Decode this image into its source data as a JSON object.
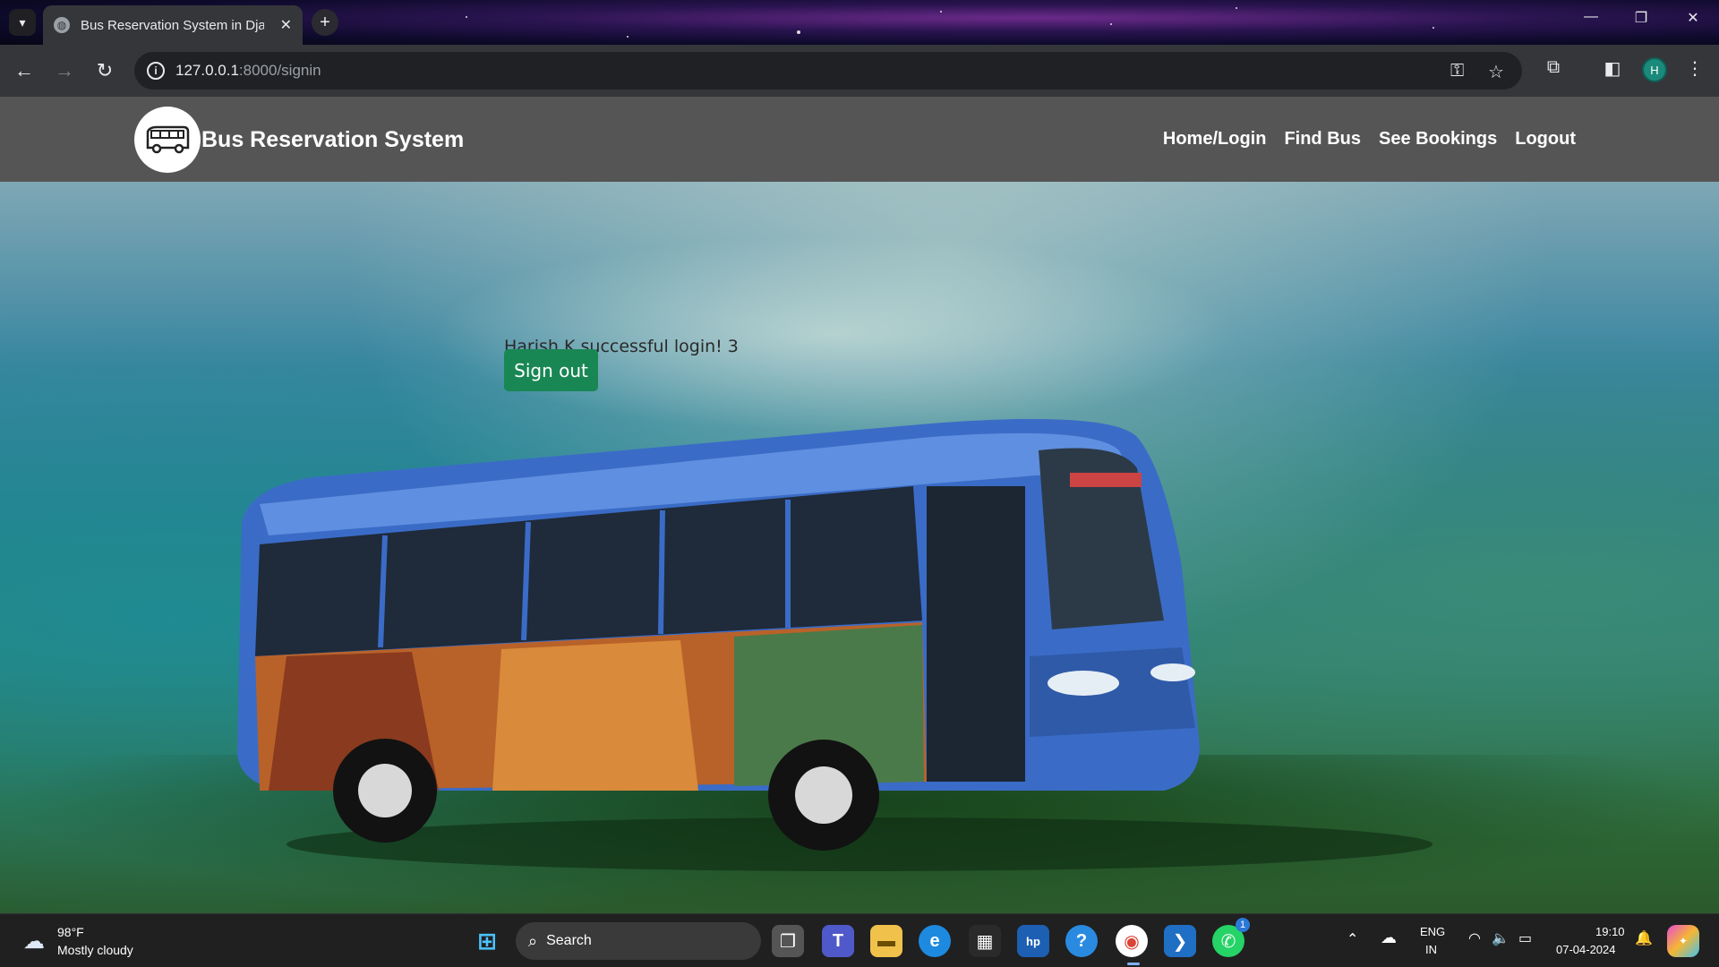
{
  "browser": {
    "tab_title": "Bus Reservation System in Djan",
    "url_host": "127.0.0.1",
    "url_path": ":8000/signin",
    "profile_initial": "H"
  },
  "navbar": {
    "brand": "Bus Reservation System",
    "links": [
      "Home/Login",
      "Find Bus",
      "See Bookings",
      "Logout"
    ]
  },
  "main": {
    "login_message": "Harish K successful login! 3",
    "signout_label": "Sign out"
  },
  "taskbar": {
    "weather_temp": "98°F",
    "weather_desc": "Mostly cloudy",
    "search_label": "Search",
    "lang_top": "ENG",
    "lang_bottom": "IN",
    "time": "19:10",
    "date": "07-04-2024",
    "whatsapp_badge": "1"
  },
  "colors": {
    "navbar_bg": "#555555",
    "signout_button": "#198754"
  }
}
